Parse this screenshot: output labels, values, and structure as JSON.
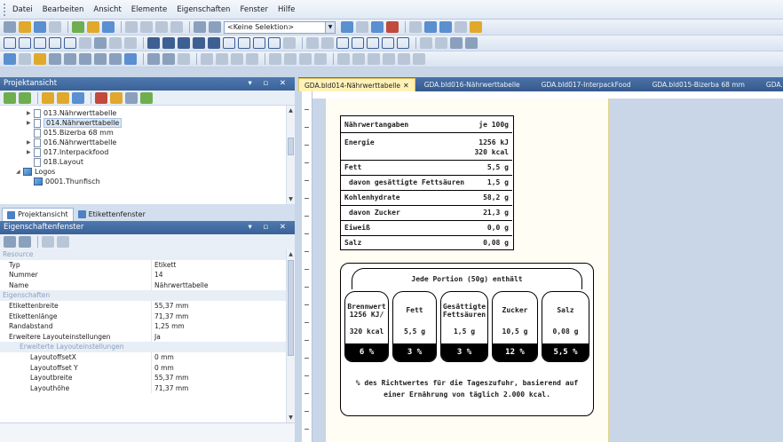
{
  "menu": [
    {
      "label": "Datei"
    },
    {
      "label": "Bearbeiten"
    },
    {
      "label": "Ansicht"
    },
    {
      "label": "Elemente"
    },
    {
      "label": "Eigenschaften"
    },
    {
      "label": "Fenster"
    },
    {
      "label": "Hilfe"
    }
  ],
  "toolbar": {
    "selection_combo": "<Keine Selektion>"
  },
  "project_panel": {
    "title": "Projektansicht",
    "tree": [
      {
        "label": "013.Nährwerttabelle",
        "expandable": true
      },
      {
        "label": "014.Nährwerttabelle",
        "expandable": true,
        "selected": true
      },
      {
        "label": "015.Bizerba 68 mm",
        "expandable": false
      },
      {
        "label": "016.Nährwerttabelle",
        "expandable": true
      },
      {
        "label": "017.Interpackfood",
        "expandable": true
      },
      {
        "label": "018.Layout",
        "expandable": false
      },
      {
        "label": "Logos",
        "expandable": true,
        "expanded": true
      },
      {
        "label": "0001.Thunfisch",
        "expandable": false
      }
    ],
    "tabs": [
      {
        "label": "Projektansicht",
        "active": true
      },
      {
        "label": "Etikettenfenster",
        "active": false
      }
    ]
  },
  "properties_panel": {
    "title": "Eigenschaftenfenster",
    "rows": [
      {
        "type": "cat",
        "key": "Resource"
      },
      {
        "type": "prop",
        "key": "Typ",
        "value": "Etikett"
      },
      {
        "type": "prop",
        "key": "Nummer",
        "value": "14"
      },
      {
        "type": "prop",
        "key": "Name",
        "value": "Nährwerttabelle"
      },
      {
        "type": "cat",
        "key": "Eigenschaften"
      },
      {
        "type": "prop",
        "key": "Etikettenbreite",
        "value": "55,37 mm"
      },
      {
        "type": "prop",
        "key": "Etikettenlänge",
        "value": "71,37 mm"
      },
      {
        "type": "prop",
        "key": "Randabstand",
        "value": "1,25 mm"
      },
      {
        "type": "prop",
        "key": "Erweitere Layouteinstellungen",
        "value": "Ja"
      },
      {
        "type": "subcat",
        "key": "Erweiterte Layouteinstellungen"
      },
      {
        "type": "subprop",
        "key": "LayoutoffsetX",
        "value": "0 mm"
      },
      {
        "type": "subprop",
        "key": "Layoutoffset Y",
        "value": "0 mm"
      },
      {
        "type": "subprop",
        "key": "Layoutbreite",
        "value": "55,37 mm"
      },
      {
        "type": "subprop",
        "key": "Layouthöhe",
        "value": "71,37 mm"
      }
    ]
  },
  "doc_tabs": [
    {
      "label": "GDA.bld014-Nährwerttabelle",
      "active": true
    },
    {
      "label": "GDA.bld016-Nährwerttabelle",
      "active": false
    },
    {
      "label": "GDA.bld017-InterpackFood",
      "active": false
    },
    {
      "label": "GDA.bld015-Bizerba 68 mm",
      "active": false
    },
    {
      "label": "GDA.bld",
      "active": false
    }
  ],
  "nutrition_table": {
    "header_left": "Nährwertangaben",
    "header_right": "je 100g",
    "rows": [
      {
        "label": "Energie",
        "value": "1256 kJ",
        "value2": "320 kcal",
        "indent": false
      },
      {
        "label": "Fett",
        "value": "5,5 g",
        "indent": false
      },
      {
        "label": "davon gesättigte Fettsäuren",
        "value": "1,5 g",
        "indent": true
      },
      {
        "label": "Kohlenhydrate",
        "value": "58,2 g",
        "indent": false
      },
      {
        "label": "davon Zucker",
        "value": "21,3 g",
        "indent": true
      },
      {
        "label": "Eiweiß",
        "value": "0,0 g",
        "indent": false
      },
      {
        "label": "Salz",
        "value": "0,08 g",
        "indent": false
      }
    ]
  },
  "gda": {
    "heading": "Jede Portion (50g) enthält",
    "columns": [
      {
        "name": "Brennwert",
        "name2": "1256 KJ/",
        "value": "320 kcal",
        "percent": "6 %"
      },
      {
        "name": "Fett",
        "name2": "",
        "value": "5,5 g",
        "percent": "3 %"
      },
      {
        "name": "Gesättigte",
        "name2": "Fettsäuren",
        "value": "1,5 g",
        "percent": "3 %"
      },
      {
        "name": "Zucker",
        "name2": "",
        "value": "10,5 g",
        "percent": "12 %"
      },
      {
        "name": "Salz",
        "name2": "",
        "value": "0,08 g",
        "percent": "5,5 %"
      }
    ],
    "footnote_line1": "% des Richtwertes für die Tageszufuhr, basierend auf",
    "footnote_line2": "einer Ernährung von täglich 2.000 kcal."
  }
}
